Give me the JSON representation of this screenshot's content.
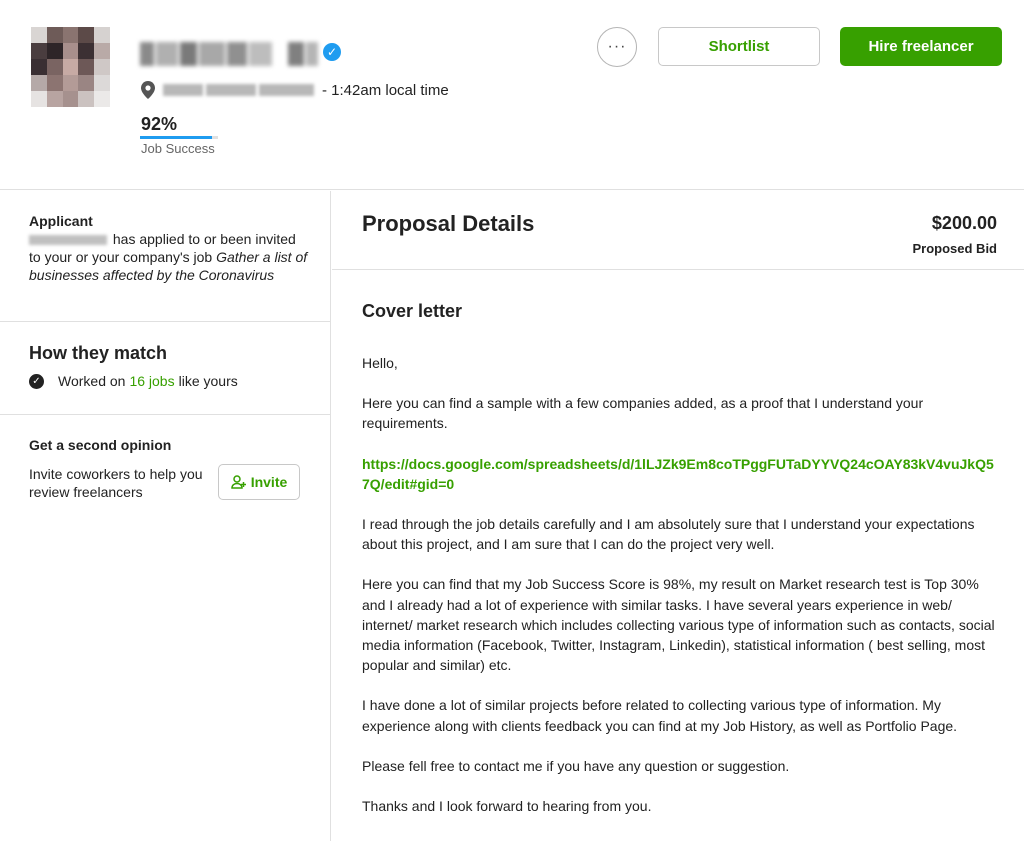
{
  "header": {
    "local_time": "- 1:42am local time",
    "job_success_value": "92%",
    "job_success_fraction": 0.92,
    "job_success_label": "Job Success",
    "more_label": "···",
    "shortlist_label": "Shortlist",
    "hire_label": "Hire freelancer",
    "accent_color": "#37a000",
    "progress_color": "#1f9cf0"
  },
  "sidebar": {
    "applicant": {
      "title": "Applicant",
      "text": "has applied to or been invited to your or your company's job",
      "job_title": "Gather a list of businesses affected by the Coronavirus"
    },
    "match": {
      "title": "How they match",
      "worked_on": "Worked on",
      "jobs_count": "16 jobs",
      "like_yours": "like yours"
    },
    "opinion": {
      "title": "Get a second opinion",
      "text": "Invite coworkers to help you review freelancers",
      "invite_label": "Invite"
    }
  },
  "proposal": {
    "title": "Proposal Details",
    "bid_amount": "$200.00",
    "bid_label": "Proposed Bid",
    "cover_title": "Cover letter",
    "paragraphs": [
      "Hello,",
      "Here you can find a sample with a few companies added, as a proof that I understand your requirements.",
      "https://docs.google.com/spreadsheets/d/1lLJZk9Em8coTPggFUTaDYYVQ24cOAY83kV4vuJkQ57Q/edit#gid=0",
      "I read through the job details carefully and I am absolutely sure that I understand your expectations about this project, and I am sure that I can do the project very well.",
      "Here you can find that my Job Success Score is 98%, my result on Market research test is Top 30% and I already had a lot of experience with similar tasks. I have several years experience in web/ internet/ market research which includes collecting various type of information such as contacts, social media information (Facebook, Twitter, Instagram, Linkedin), statistical information ( best selling, most popular and similar) etc.",
      "I have done a lot of similar projects before related to collecting various type of information. My experience along with clients feedback you can find at my Job History, as well as Portfolio Page.",
      "Please fell free to contact me if you have any question or suggestion.",
      "Thanks and I look forward to hearing from you."
    ]
  }
}
